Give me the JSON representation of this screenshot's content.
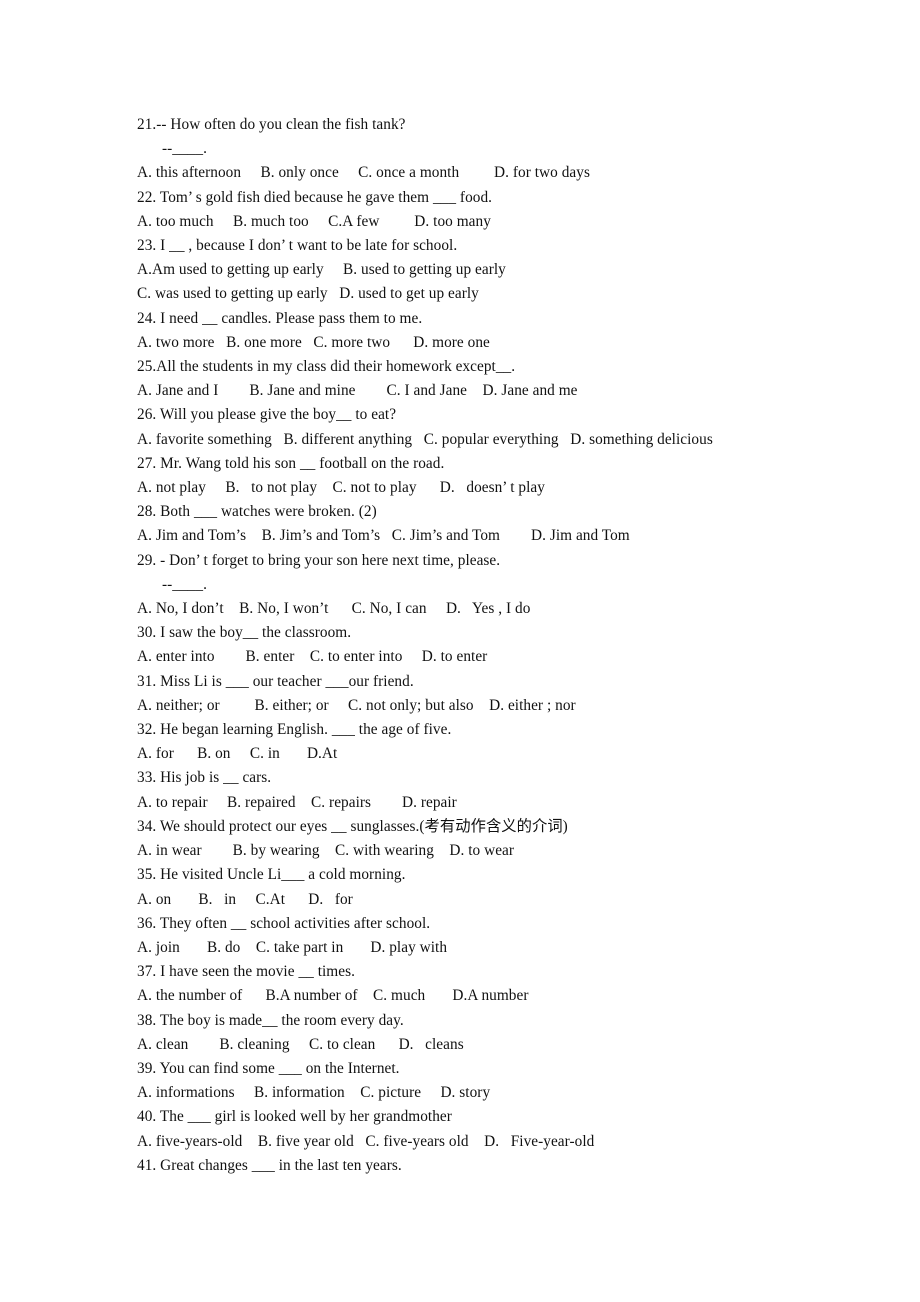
{
  "document": {
    "type": "multiple-choice-worksheet",
    "background_color": "#ffffff",
    "text_color": "#111111",
    "lines": [
      {
        "id": "q21-stem",
        "text": "21.-- How often do you clean the fish tank?",
        "indent": false
      },
      {
        "id": "q21-reply",
        "text": "--____.",
        "indent": true
      },
      {
        "id": "q21-options",
        "text": "A. this afternoon     B. only once     C. once a month         D. for two days",
        "indent": false
      },
      {
        "id": "q22-stem",
        "text": "22. Tom’ s gold fish died because he gave them ___ food.",
        "indent": false
      },
      {
        "id": "q22-options",
        "text": "A. too much     B. much too     C.A few         D. too many",
        "indent": false
      },
      {
        "id": "q23-stem",
        "text": "23. I __ , because I don’ t want to be late for school.",
        "indent": false
      },
      {
        "id": "q23-options-ab",
        "text": "A.Am used to getting up early     B. used to getting up early",
        "indent": false
      },
      {
        "id": "q23-options-cd",
        "text": "C. was used to getting up early   D. used to get up early",
        "indent": false
      },
      {
        "id": "q24-stem",
        "text": "24. I need __ candles. Please pass them to me.",
        "indent": false
      },
      {
        "id": "q24-options",
        "text": "A. two more   B. one more   C. more two      D. more one",
        "indent": false
      },
      {
        "id": "q25-stem",
        "text": "25.All the students in my class did their homework except__.",
        "indent": false
      },
      {
        "id": "q25-options",
        "text": "A. Jane and I        B. Jane and mine        C. I and Jane    D. Jane and me",
        "indent": false
      },
      {
        "id": "q26-stem",
        "text": "26. Will you please give the boy__ to eat?",
        "indent": false
      },
      {
        "id": "q26-options",
        "text": "A. favorite something   B. different anything   C. popular everything   D. something delicious",
        "indent": false
      },
      {
        "id": "q27-stem",
        "text": "27. Mr. Wang told his son __ football on the road.",
        "indent": false
      },
      {
        "id": "q27-options",
        "text": "A. not play     B.   to not play    C. not to play      D.   doesn’ t play",
        "indent": false
      },
      {
        "id": "q28-stem",
        "text": "28. Both ___ watches were broken. (2)",
        "indent": false
      },
      {
        "id": "q28-options",
        "text": "A. Jim and Tom’s    B. Jim’s and Tom’s   C. Jim’s and Tom        D. Jim and Tom",
        "indent": false
      },
      {
        "id": "q29-stem",
        "text": "29. - Don’ t forget to bring your son here next time, please.",
        "indent": false
      },
      {
        "id": "q29-reply",
        "text": "--____.",
        "indent": true
      },
      {
        "id": "q29-options",
        "text": "A. No, I don’t    B. No, I won’t      C. No, I can     D.   Yes , I do",
        "indent": false
      },
      {
        "id": "q30-stem",
        "text": "30. I saw the boy__ the classroom.",
        "indent": false
      },
      {
        "id": "q30-options",
        "text": "A. enter into        B. enter    C. to enter into     D. to enter",
        "indent": false
      },
      {
        "id": "q31-stem",
        "text": "31. Miss Li is ___ our teacher ___our friend.",
        "indent": false
      },
      {
        "id": "q31-options",
        "text": "A. neither; or         B. either; or     C. not only; but also    D. either ; nor",
        "indent": false
      },
      {
        "id": "q32-stem",
        "text": "32. He began learning English. ___ the age of five.",
        "indent": false
      },
      {
        "id": "q32-options",
        "text": "A. for      B. on     C. in       D.At",
        "indent": false
      },
      {
        "id": "q33-stem",
        "text": "33. His job is __ cars.",
        "indent": false
      },
      {
        "id": "q33-options",
        "text": "A. to repair     B. repaired    C. repairs        D. repair",
        "indent": false
      },
      {
        "id": "q34-stem",
        "text": "34. We should protect our eyes __ sunglasses.(考有动作含义的介词)",
        "indent": false
      },
      {
        "id": "q34-options",
        "text": "A. in wear        B. by wearing    C. with wearing    D. to wear",
        "indent": false
      },
      {
        "id": "q35-stem",
        "text": "35. He visited Uncle Li___ a cold morning.",
        "indent": false
      },
      {
        "id": "q35-options",
        "text": "A. on       B.   in     C.At      D.   for",
        "indent": false
      },
      {
        "id": "q36-stem",
        "text": "36. They often __ school activities after school.",
        "indent": false
      },
      {
        "id": "q36-options",
        "text": "A. join       B. do    C. take part in       D. play with",
        "indent": false
      },
      {
        "id": "q37-stem",
        "text": "37. I have seen the movie __ times.",
        "indent": false
      },
      {
        "id": "q37-options",
        "text": "A. the number of      B.A number of    C. much       D.A number",
        "indent": false
      },
      {
        "id": "q38-stem",
        "text": "38. The boy is made__ the room every day.",
        "indent": false
      },
      {
        "id": "q38-options",
        "text": "A. clean        B. cleaning     C. to clean      D.   cleans",
        "indent": false
      },
      {
        "id": "q39-stem",
        "text": "39. You can find some ___ on the Internet.",
        "indent": false
      },
      {
        "id": "q39-options",
        "text": "A. informations     B. information    C. picture     D. story",
        "indent": false
      },
      {
        "id": "q40-stem",
        "text": "40. The ___ girl is looked well by her grandmother",
        "indent": false
      },
      {
        "id": "q40-options",
        "text": "A. five-years-old    B. five year old   C. five-years old    D.   Five-year-old",
        "indent": false
      },
      {
        "id": "q41-stem",
        "text": "41. Great changes ___ in the last ten years.",
        "indent": false
      }
    ]
  }
}
